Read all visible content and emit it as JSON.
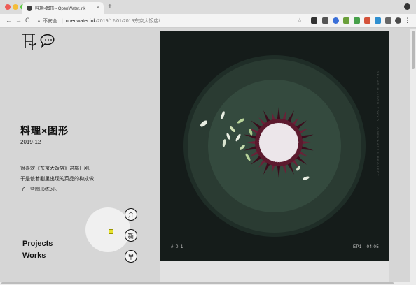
{
  "browser": {
    "tab_title": "料理×图形 - OpenWater.ink",
    "tab_close": "×",
    "new_tab": "+",
    "nav_back": "←",
    "nav_forward": "→",
    "nav_reload": "C",
    "security_icon": "▲",
    "security_label": "不安全",
    "url_host": "openwater.ink",
    "url_path": "/2019/12/01/2019东京大饭店/",
    "bookmark_star": "☆",
    "menu": "⋮"
  },
  "page": {
    "title": "料理×图形",
    "date": "2019-12",
    "description": [
      "很喜欢《东京大饭店》这部日剧,",
      "于是依着剧里出现的菜品的构成做",
      "了一些图形练习。"
    ],
    "nav_buttons": [
      "介",
      "新",
      "早"
    ],
    "projects_label": "Projects",
    "works_label": "Works"
  },
  "artwork": {
    "number": "# 0 1",
    "episode": "EP1 - 04:05",
    "vertical_text": "GRAND MAISON TOKYO · OPENWATER PROJECT"
  },
  "colors": {
    "artwork_bg": "#151c1a",
    "plate_outer": "#2a3b32",
    "plate_inner": "#3a5446",
    "spikes": "#3b0d1c",
    "center": "#ece6ea",
    "cursor_highlight": "#e7e22e"
  }
}
